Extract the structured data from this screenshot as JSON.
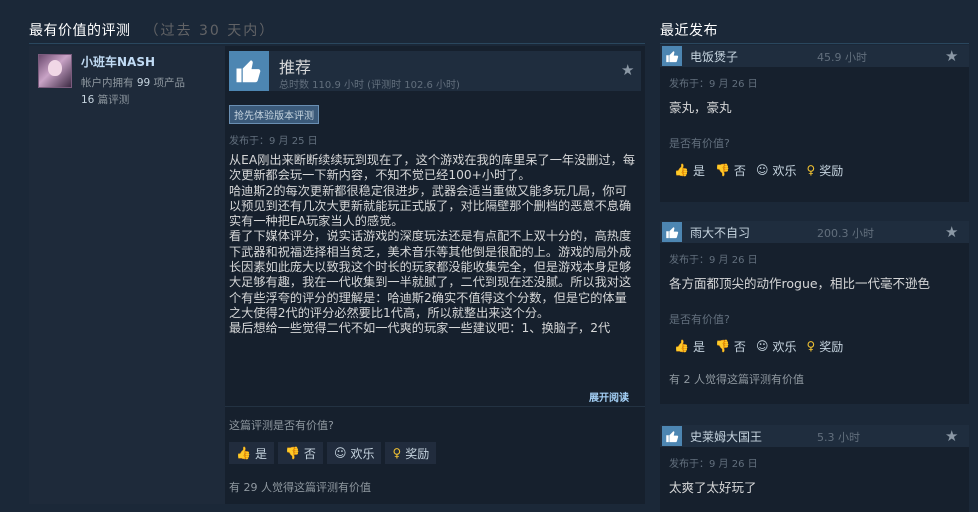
{
  "header": {
    "left_title": "最有价值的评测",
    "left_period": "（过去 30 天内）",
    "right_title": "最近发布"
  },
  "review": {
    "author_name": "小班车NASH",
    "owned_prefix": "帐户内拥有 ",
    "owned_count": "99",
    "owned_suffix": " 项产品",
    "reviews_count": "16",
    "reviews_suffix": " 篇评测",
    "recommendation": "推荐",
    "hours": "总时数 110.9 小时  (评测时 102.6 小时)",
    "badge": "抢先体验版本评测",
    "posted": "发布于：9 月 25 日",
    "paragraphs": [
      "从EA刚出来断断续续玩到现在了，这个游戏在我的库里呆了一年没删过，每次更新都会玩一下新内容，不知不觉已经100+小时了。",
      "哈迪斯2的每次更新都很稳定很进步，武器会适当重做又能多玩几局，你可以预见到还有几次大更新就能玩正式版了，对比隔壁那个删档的恶意不息确实有一种把EA玩家当人的感觉。",
      "看了下媒体评分，说实话游戏的深度玩法还是有点配不上双十分的，高热度下武器和祝福选择相当贫乏，美术音乐等其他倒是很配的上。游戏的局外成长因素如此庞大以致我这个时长的玩家都没能收集完全，但是游戏本身足够大足够有趣，我在一代收集到一半就腻了，二代到现在还没腻。所以我对这个有些浮夸的评分的理解是：哈迪斯2确实不值得这个分数，但是它的体量之大使得2代的评分必然要比1代高，所以就整出来这个分。",
      "最后想给一些觉得二代不如一代爽的玩家一些建议吧：1、换脑子，2代"
    ],
    "expand": "展开阅读",
    "helpful_question": "这篇评测是否有价值?",
    "votes": {
      "yes": "是",
      "no": "否",
      "funny": "欢乐",
      "award": "奖励"
    },
    "helpful_count": "有 29 人觉得这篇评测有价值"
  },
  "recent": [
    {
      "name": "电饭煲子",
      "hours": "45.9 小时",
      "posted": "发布于：9 月 26 日",
      "text": "豪丸，豪丸",
      "question": "是否有价值?",
      "votes": {
        "yes": "是",
        "no": "否",
        "funny": "欢乐",
        "award": "奖励"
      },
      "helpful_count": ""
    },
    {
      "name": "雨大不自习",
      "hours": "200.3 小时",
      "posted": "发布于：9 月 26 日",
      "text": "各方面都顶尖的动作rogue，相比一代毫不逊色",
      "question": "是否有价值?",
      "votes": {
        "yes": "是",
        "no": "否",
        "funny": "欢乐",
        "award": "奖励"
      },
      "helpful_count": "有 2 人觉得这篇评测有价值"
    },
    {
      "name": "史莱姆大国王",
      "hours": "5.3 小时",
      "posted": "发布于：9 月 26 日",
      "text": "太爽了太好玩了",
      "question": "",
      "votes": {},
      "helpful_count": ""
    }
  ]
}
